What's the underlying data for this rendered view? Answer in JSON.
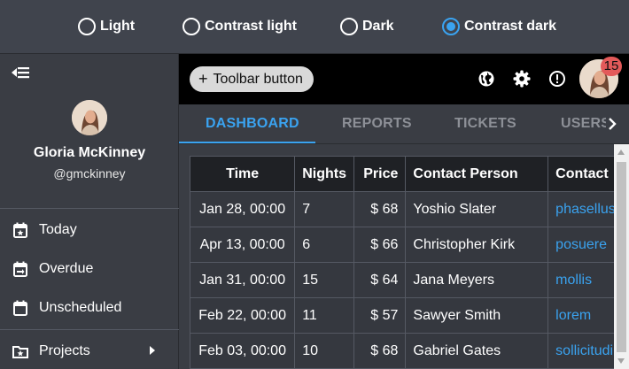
{
  "theme_bar": {
    "options": [
      {
        "label": "Light",
        "selected": false
      },
      {
        "label": "Contrast light",
        "selected": false
      },
      {
        "label": "Dark",
        "selected": false
      },
      {
        "label": "Contrast dark",
        "selected": true
      }
    ]
  },
  "sidebar": {
    "collapse_icon": "arrow-collapse-left-icon",
    "user": {
      "name": "Gloria McKinney",
      "handle": "@gmckinney"
    },
    "items": [
      {
        "label": "Today",
        "icon": "calendar-star-icon"
      },
      {
        "label": "Overdue",
        "icon": "calendar-arrows-icon"
      },
      {
        "label": "Unscheduled",
        "icon": "calendar-blank-icon"
      },
      {
        "label": "Projects",
        "icon": "folder-star-icon",
        "has_submenu": true
      }
    ]
  },
  "toolbar": {
    "button_label": "Toolbar button",
    "icons": [
      "globe-icon",
      "gear-icon",
      "alert-circle-icon"
    ],
    "notification_count": "15"
  },
  "tabs": [
    {
      "label": "DASHBOARD",
      "active": true
    },
    {
      "label": "REPORTS",
      "active": false
    },
    {
      "label": "TICKETS",
      "active": false
    },
    {
      "label": "USERS",
      "active": false
    }
  ],
  "table": {
    "columns": [
      "Time",
      "Nights",
      "Price",
      "Contact Person",
      "Contact"
    ],
    "rows": [
      {
        "time": "Jan 28, 00:00",
        "nights": "7",
        "price": "$ 68",
        "contact": "Yoshio Slater",
        "info": "phasellus"
      },
      {
        "time": "Apr 13, 00:00",
        "nights": "6",
        "price": "$ 66",
        "contact": "Christopher Kirk",
        "info": "posuere"
      },
      {
        "time": "Jan 31, 00:00",
        "nights": "15",
        "price": "$ 64",
        "contact": "Jana Meyers",
        "info": "mollis"
      },
      {
        "time": "Feb 22, 00:00",
        "nights": "11",
        "price": "$ 57",
        "contact": "Sawyer Smith",
        "info": "lorem"
      },
      {
        "time": "Feb 03, 00:00",
        "nights": "10",
        "price": "$ 68",
        "contact": "Gabriel Gates",
        "info": "sollicitudin"
      }
    ]
  },
  "colors": {
    "accent": "#3aa3f0",
    "badge": "#e35a5a",
    "background": "#3a3d44",
    "toolbar": "#000000"
  }
}
